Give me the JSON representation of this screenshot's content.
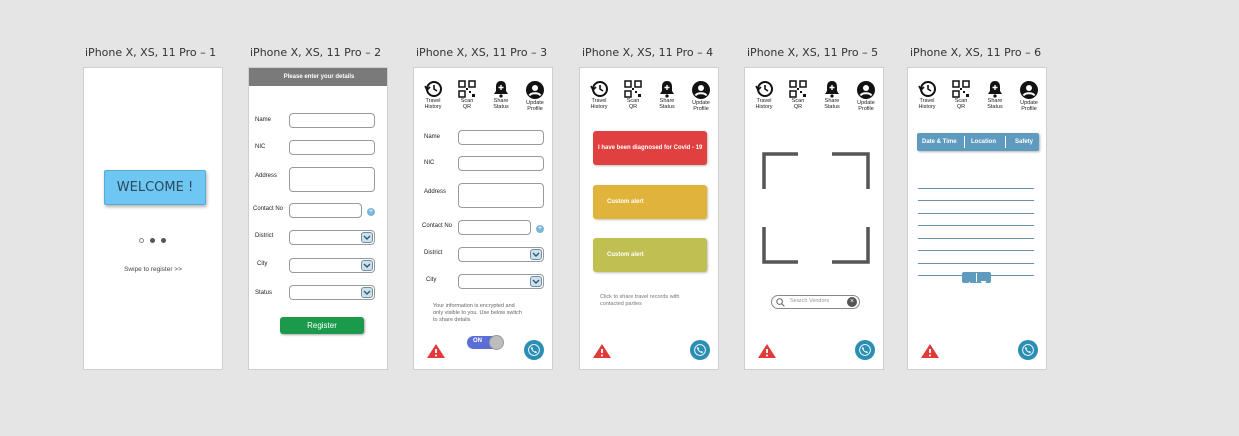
{
  "artboards": [
    {
      "title": "iPhone X, XS, 11 Pro – 1"
    },
    {
      "title": "iPhone X, XS, 11 Pro – 2"
    },
    {
      "title": "iPhone X, XS, 11 Pro – 3"
    },
    {
      "title": "iPhone X, XS, 11 Pro – 4"
    },
    {
      "title": "iPhone X, XS, 11 Pro – 5"
    },
    {
      "title": "iPhone X, XS, 11 Pro – 6"
    }
  ],
  "welcome": {
    "button": "WELCOME !",
    "swipe": "Swipe to register >>"
  },
  "register": {
    "header": "Please enter your details",
    "labels": {
      "name": "Name",
      "nic": "NIC",
      "address": "Address",
      "contact": "Contact No",
      "district": "District",
      "city": "City",
      "status": "Status"
    },
    "button": "Register"
  },
  "toolbar": {
    "travel_history": [
      "Travel",
      "History"
    ],
    "scan_qr": [
      "Scan",
      "QR"
    ],
    "share_status": [
      "Share",
      "Status"
    ],
    "update_profile": [
      "Update",
      "Profile"
    ]
  },
  "profile": {
    "labels": {
      "name": "Name",
      "nic": "NIC",
      "address": "Address",
      "contact": "Contact No",
      "district": "District",
      "city": "City"
    },
    "info": [
      "Your information is encrypted and",
      "only visible to you. Use below switch",
      "to share details"
    ],
    "toggle": "ON"
  },
  "status": {
    "covid": "I have been diagnosed for Covid - 19",
    "custom1": "Custom alert",
    "custom2": "Custom alert",
    "share_note": [
      "Click to share travel records with",
      "contacted parties"
    ]
  },
  "scan": {
    "search_placeholder": "Search Vendors"
  },
  "history": {
    "headers": [
      "Date & Time",
      "Location",
      "Safety"
    ],
    "rows": 8
  },
  "colors": {
    "welcome": "#6ec6f2",
    "register": "#1a9a4a",
    "header": "#7a7a7a",
    "covid": "#e04040",
    "custom1": "#e0b33a",
    "custom2": "#bfbf52",
    "table_header": "#5e9bbf",
    "toggle": "#5b6ed8",
    "call": "#2a8fb3",
    "warn": "#e03a3a"
  }
}
